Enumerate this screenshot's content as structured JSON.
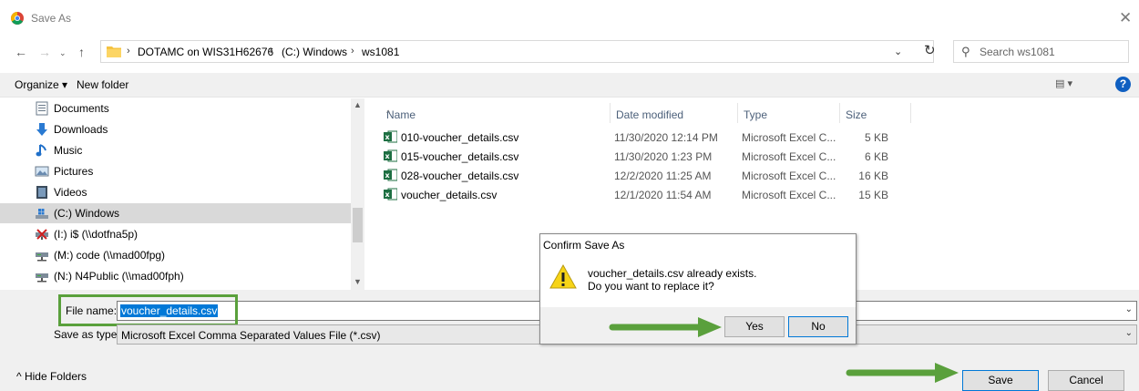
{
  "window": {
    "title": "Save As",
    "close_glyph": "✕"
  },
  "address": {
    "back": "←",
    "forward": "→",
    "history": "⌄",
    "up": "↑",
    "crumbs": [
      "DOTAMC on WIS31H62676",
      "(C:) Windows",
      "ws1081"
    ],
    "separator": "›",
    "dropdown": "⌄",
    "refresh": "↻",
    "search_placeholder": "Search ws1081"
  },
  "toolbar": {
    "organize_label": "Organize ▾",
    "new_folder_label": "New folder",
    "views_glyph": "▤ ▾",
    "help_glyph": "?"
  },
  "nav_pane": {
    "items": [
      {
        "label": "Documents",
        "icon": "documents-icon"
      },
      {
        "label": "Downloads",
        "icon": "downloads-icon"
      },
      {
        "label": "Music",
        "icon": "music-icon"
      },
      {
        "label": "Pictures",
        "icon": "pictures-icon"
      },
      {
        "label": "Videos",
        "icon": "videos-icon"
      },
      {
        "label": "(C:) Windows",
        "icon": "drive-icon",
        "selected": true
      },
      {
        "label": "(I:) i$ (\\\\dotfna5p)",
        "icon": "network-drive-disconnected-icon"
      },
      {
        "label": "(M:) code (\\\\mad00fpg)",
        "icon": "network-drive-icon"
      },
      {
        "label": "(N:) N4Public (\\\\mad00fph)",
        "icon": "network-drive-icon"
      }
    ]
  },
  "file_list": {
    "columns": [
      "Name",
      "Date modified",
      "Type",
      "Size"
    ],
    "sort_caret": "^",
    "rows": [
      {
        "name": "010-voucher_details.csv",
        "date": "11/30/2020 12:14 PM",
        "type": "Microsoft Excel C...",
        "size": "5 KB"
      },
      {
        "name": "015-voucher_details.csv",
        "date": "11/30/2020 1:23 PM",
        "type": "Microsoft Excel C...",
        "size": "6 KB"
      },
      {
        "name": "028-voucher_details.csv",
        "date": "12/2/2020 11:25 AM",
        "type": "Microsoft Excel C...",
        "size": "16 KB"
      },
      {
        "name": "voucher_details.csv",
        "date": "12/1/2020 11:54 AM",
        "type": "Microsoft Excel C...",
        "size": "15 KB"
      }
    ]
  },
  "bottom": {
    "file_name_label": "File name:",
    "file_name_value": "voucher_details.csv",
    "save_type_label": "Save as type:",
    "save_type_value": "Microsoft Excel Comma Separated Values File (*.csv)",
    "hide_folders_label": "^  Hide Folders",
    "save_label": "Save",
    "cancel_label": "Cancel",
    "dropdown": "⌄"
  },
  "confirm_dialog": {
    "title": "Confirm Save As",
    "message_line1": "voucher_details.csv already exists.",
    "message_line2": "Do you want to replace it?",
    "yes_label": "Yes",
    "no_label": "No"
  },
  "colors": {
    "accent_green": "#5aa03c",
    "selection_blue": "#0078d7",
    "excel_green": "#1d6f42",
    "folder_yellow": "#f5c342",
    "warning_yellow": "#f7d417"
  }
}
